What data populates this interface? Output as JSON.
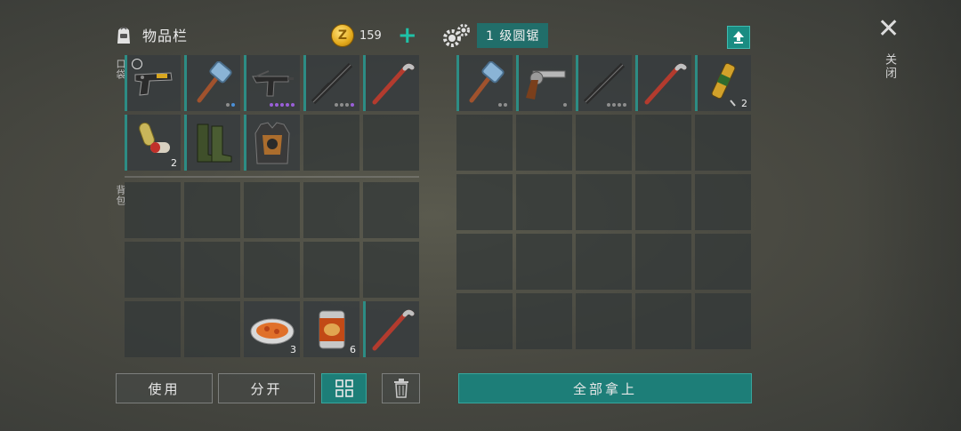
{
  "inventory": {
    "title": "物品栏",
    "coins": "159",
    "coin_glyph": "Z",
    "pocket_label": "口袋",
    "backpack_label": "背包",
    "pocket_items": [
      {
        "name": "pistol",
        "count": "",
        "dots": []
      },
      {
        "name": "sledgehammer",
        "count": "",
        "dots": [
          "g",
          "b"
        ]
      },
      {
        "name": "uzi",
        "count": "",
        "dots": [
          "p",
          "p",
          "p",
          "p",
          "p"
        ]
      },
      {
        "name": "assault-rifle",
        "count": "",
        "dots": [
          "g",
          "g",
          "g",
          "p"
        ]
      },
      {
        "name": "crowbar",
        "count": "",
        "dots": []
      },
      {
        "name": "painkiller-pills",
        "count": "2",
        "dots": []
      },
      {
        "name": "rubber-boots",
        "count": "",
        "dots": []
      },
      {
        "name": "armor-vest",
        "count": "",
        "dots": []
      }
    ],
    "backpack_items": [
      {
        "slot": 12,
        "name": "cooked-food",
        "count": "3"
      },
      {
        "slot": 13,
        "name": "canned-food",
        "count": "6"
      },
      {
        "slot": 14,
        "name": "crowbar",
        "count": ""
      }
    ]
  },
  "buttons": {
    "use": "使用",
    "split": "分开",
    "take_all": "全部拿上"
  },
  "container": {
    "title": "1 级圆锯",
    "items": [
      {
        "name": "sledgehammer",
        "count": "",
        "dots": [
          "g",
          "g"
        ]
      },
      {
        "name": "revolver",
        "count": "",
        "dots": [
          "g"
        ]
      },
      {
        "name": "assault-rifle",
        "count": "",
        "dots": [
          "g",
          "g",
          "g",
          "g"
        ]
      },
      {
        "name": "crowbar",
        "count": "",
        "dots": []
      },
      {
        "name": "adrenaline-syringe",
        "count": "2",
        "dots": []
      }
    ]
  },
  "close_label": "关闭",
  "close_glyph": "✕",
  "colors": {
    "accent": "#1d7e78",
    "coin": "#e3a91b",
    "plus": "#1fc1a7"
  }
}
